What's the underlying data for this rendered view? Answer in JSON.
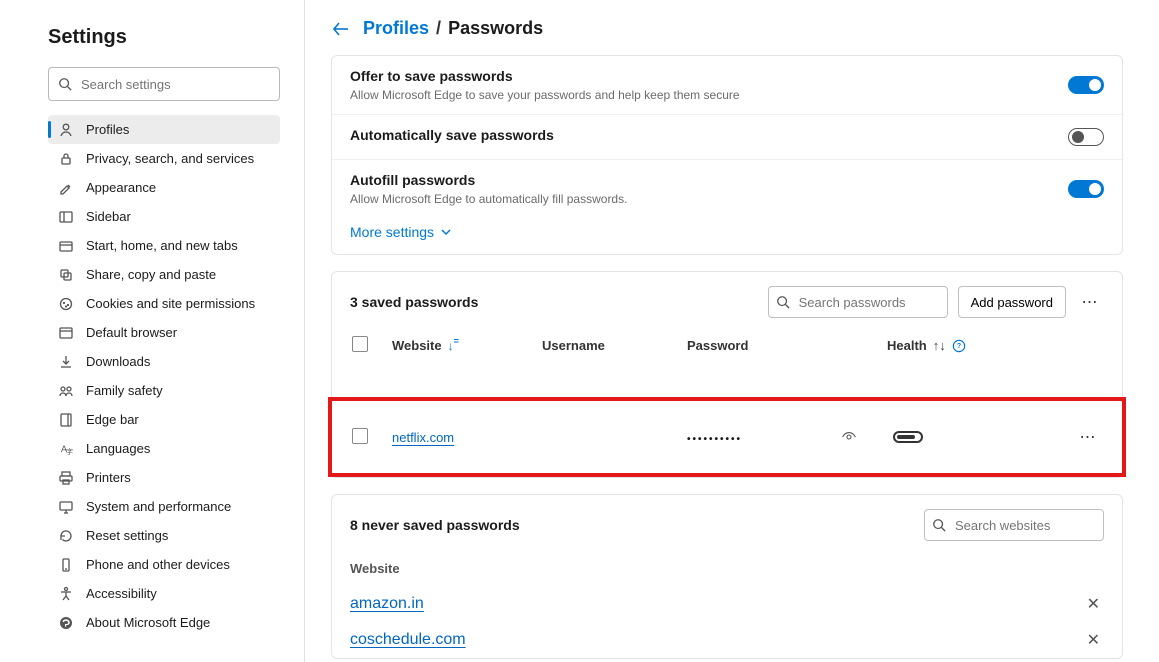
{
  "sidebar": {
    "title": "Settings",
    "searchPlaceholder": "Search settings",
    "items": [
      {
        "label": "Profiles",
        "name": "sidebar-item-profiles",
        "icon": "profile",
        "active": true
      },
      {
        "label": "Privacy, search, and services",
        "name": "sidebar-item-privacy",
        "icon": "lock"
      },
      {
        "label": "Appearance",
        "name": "sidebar-item-appearance",
        "icon": "appearance"
      },
      {
        "label": "Sidebar",
        "name": "sidebar-item-sidebar",
        "icon": "sidebar"
      },
      {
        "label": "Start, home, and new tabs",
        "name": "sidebar-item-start",
        "icon": "tabs"
      },
      {
        "label": "Share, copy and paste",
        "name": "sidebar-item-share",
        "icon": "share"
      },
      {
        "label": "Cookies and site permissions",
        "name": "sidebar-item-cookies",
        "icon": "cookies"
      },
      {
        "label": "Default browser",
        "name": "sidebar-item-default",
        "icon": "browser"
      },
      {
        "label": "Downloads",
        "name": "sidebar-item-downloads",
        "icon": "download"
      },
      {
        "label": "Family safety",
        "name": "sidebar-item-family",
        "icon": "family"
      },
      {
        "label": "Edge bar",
        "name": "sidebar-item-edgebar",
        "icon": "edgebar"
      },
      {
        "label": "Languages",
        "name": "sidebar-item-languages",
        "icon": "languages"
      },
      {
        "label": "Printers",
        "name": "sidebar-item-printers",
        "icon": "printers"
      },
      {
        "label": "System and performance",
        "name": "sidebar-item-system",
        "icon": "system"
      },
      {
        "label": "Reset settings",
        "name": "sidebar-item-reset",
        "icon": "reset"
      },
      {
        "label": "Phone and other devices",
        "name": "sidebar-item-phone",
        "icon": "phone"
      },
      {
        "label": "Accessibility",
        "name": "sidebar-item-accessibility",
        "icon": "accessibility"
      },
      {
        "label": "About Microsoft Edge",
        "name": "sidebar-item-about",
        "icon": "about"
      }
    ]
  },
  "breadcrumb": {
    "parent": "Profiles",
    "current": "Passwords"
  },
  "settings": {
    "offer": {
      "title": "Offer to save passwords",
      "desc": "Allow Microsoft Edge to save your passwords and help keep them secure",
      "on": true
    },
    "auto": {
      "title": "Automatically save passwords",
      "on": false
    },
    "autofill": {
      "title": "Autofill passwords",
      "desc": "Allow Microsoft Edge to automatically fill passwords.",
      "on": true
    },
    "moreLabel": "More settings"
  },
  "passwords": {
    "countLabel": "3 saved passwords",
    "searchPlaceholder": "Search passwords",
    "addLabel": "Add password",
    "columns": {
      "site": "Website",
      "user": "Username",
      "pass": "Password",
      "health": "Health"
    },
    "highlighted": {
      "site": "netflix.com",
      "pass": "••••••••••"
    }
  },
  "neverSaved": {
    "countLabel": "8 never saved passwords",
    "searchPlaceholder": "Search websites",
    "colLabel": "Website",
    "items": [
      "amazon.in",
      "coschedule.com"
    ]
  }
}
